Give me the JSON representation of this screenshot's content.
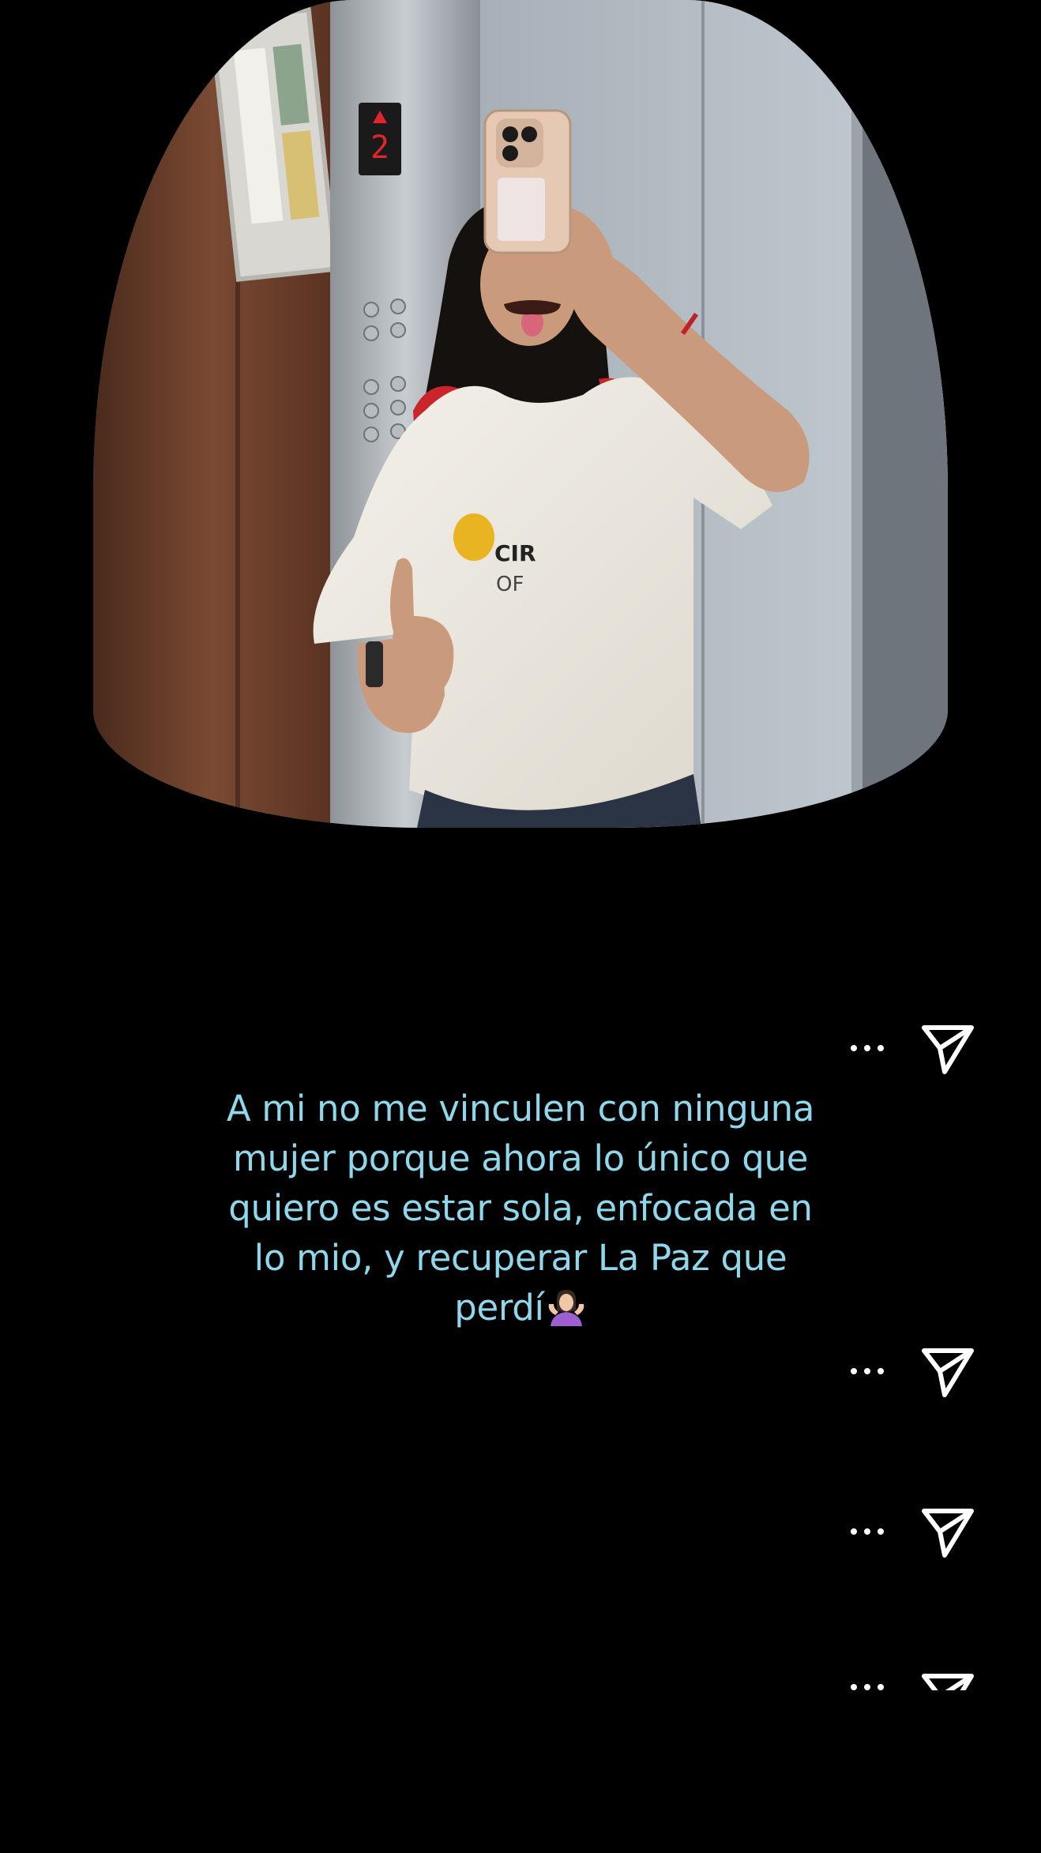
{
  "post": {
    "caption_lines": [
      "A mi no me vinculen con ninguna",
      "mujer porque ahora lo único que",
      "quiero es estar sola, enfocada en",
      "lo mio, y recuperar La Paz que",
      "perdí"
    ],
    "caption_emoji": "shrug-emoji",
    "caption_color": "#8fd7ea",
    "photo": {
      "description_icon": "elevator-mirror-selfie",
      "elevator_floor_display": "2"
    }
  },
  "actions": [
    {
      "more_icon": "more-dots-icon",
      "share_icon": "send-paper-plane-icon"
    },
    {
      "more_icon": "more-dots-icon",
      "share_icon": "send-paper-plane-icon"
    },
    {
      "more_icon": "more-dots-icon",
      "share_icon": "send-paper-plane-icon"
    },
    {
      "more_icon": "more-dots-icon",
      "share_icon": "send-paper-plane-icon"
    }
  ],
  "theme": {
    "background": "#000000",
    "icon_color": "#ffffff"
  }
}
